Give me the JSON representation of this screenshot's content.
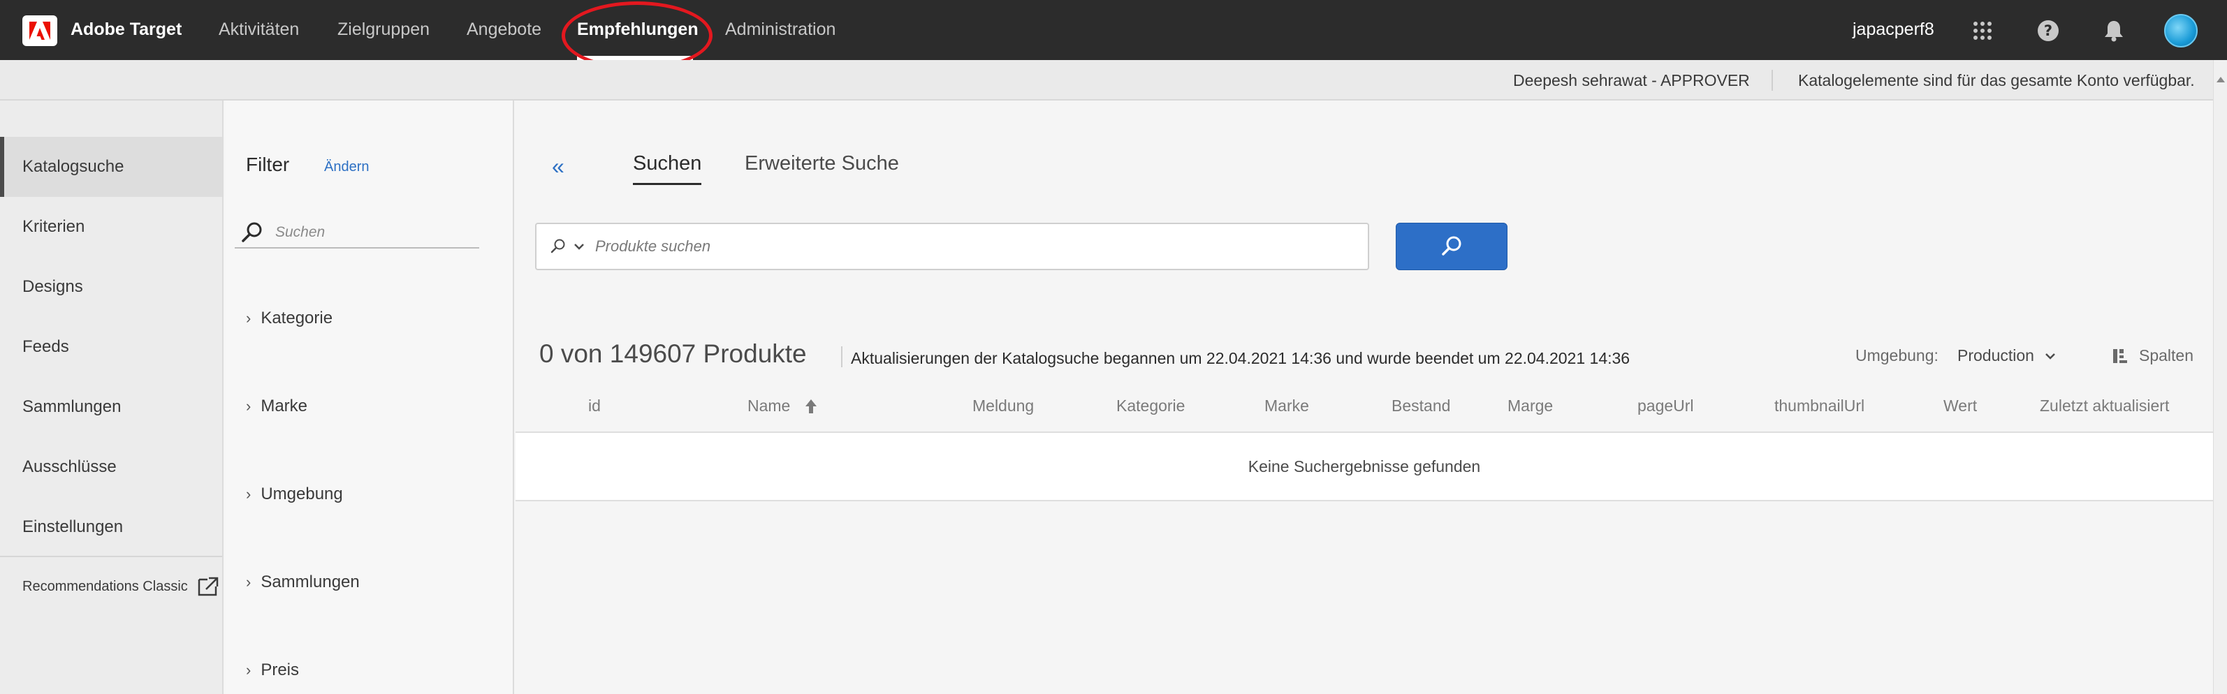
{
  "header": {
    "app_name": "Adobe Target",
    "logo_icon": "adobe-logo-icon",
    "nav": [
      {
        "label": "Aktivitäten"
      },
      {
        "label": "Zielgruppen"
      },
      {
        "label": "Angebote"
      },
      {
        "label": "Empfehlungen",
        "active": true
      },
      {
        "label": "Administration"
      }
    ],
    "user": "japacperf8",
    "icons": [
      "apps-grid-icon",
      "help-icon",
      "notification-bell-icon",
      "avatar"
    ]
  },
  "subbar": {
    "approver": "Deepesh sehrawat - APPROVER",
    "notice": "Katalogelemente sind für das gesamte Konto verfügbar."
  },
  "leftnav": {
    "items": [
      {
        "label": "Katalogsuche",
        "active": true
      },
      {
        "label": "Kriterien"
      },
      {
        "label": "Designs"
      },
      {
        "label": "Feeds"
      },
      {
        "label": "Sammlungen"
      },
      {
        "label": "Ausschlüsse"
      },
      {
        "label": "Einstellungen"
      }
    ],
    "classic": "Recommendations Classic"
  },
  "filter": {
    "title": "Filter",
    "change": "Ändern",
    "search_placeholder": "Suchen",
    "facets": [
      {
        "label": "Kategorie"
      },
      {
        "label": "Marke"
      },
      {
        "label": "Umgebung"
      },
      {
        "label": "Sammlungen"
      },
      {
        "label": "Preis"
      }
    ]
  },
  "main": {
    "tabs": [
      {
        "label": "Suchen",
        "active": true
      },
      {
        "label": "Erweiterte Suche"
      }
    ],
    "search_placeholder": "Produkte suchen",
    "count": "0 von 149607 Produkte",
    "update_text": "Aktualisierungen der Katalogsuche begannen um 22.04.2021 14:36 und wurde beendet um 22.04.2021 14:36",
    "environment_label": "Umgebung:",
    "environment_value": "Production",
    "columns_label": "Spalten",
    "columns": [
      "id",
      "Name",
      "Meldung",
      "Kategorie",
      "Marke",
      "Bestand",
      "Marge",
      "pageUrl",
      "thumbnailUrl",
      "Wert",
      "Zuletzt aktualisiert"
    ],
    "sorted_column": "Name",
    "empty_message": "Keine Suchergebnisse gefunden"
  },
  "colors": {
    "topbar": "#2c2c2c",
    "accent_blue": "#2d6fc7",
    "highlight_red": "#e3181f",
    "adobe_red": "#eb1000"
  }
}
